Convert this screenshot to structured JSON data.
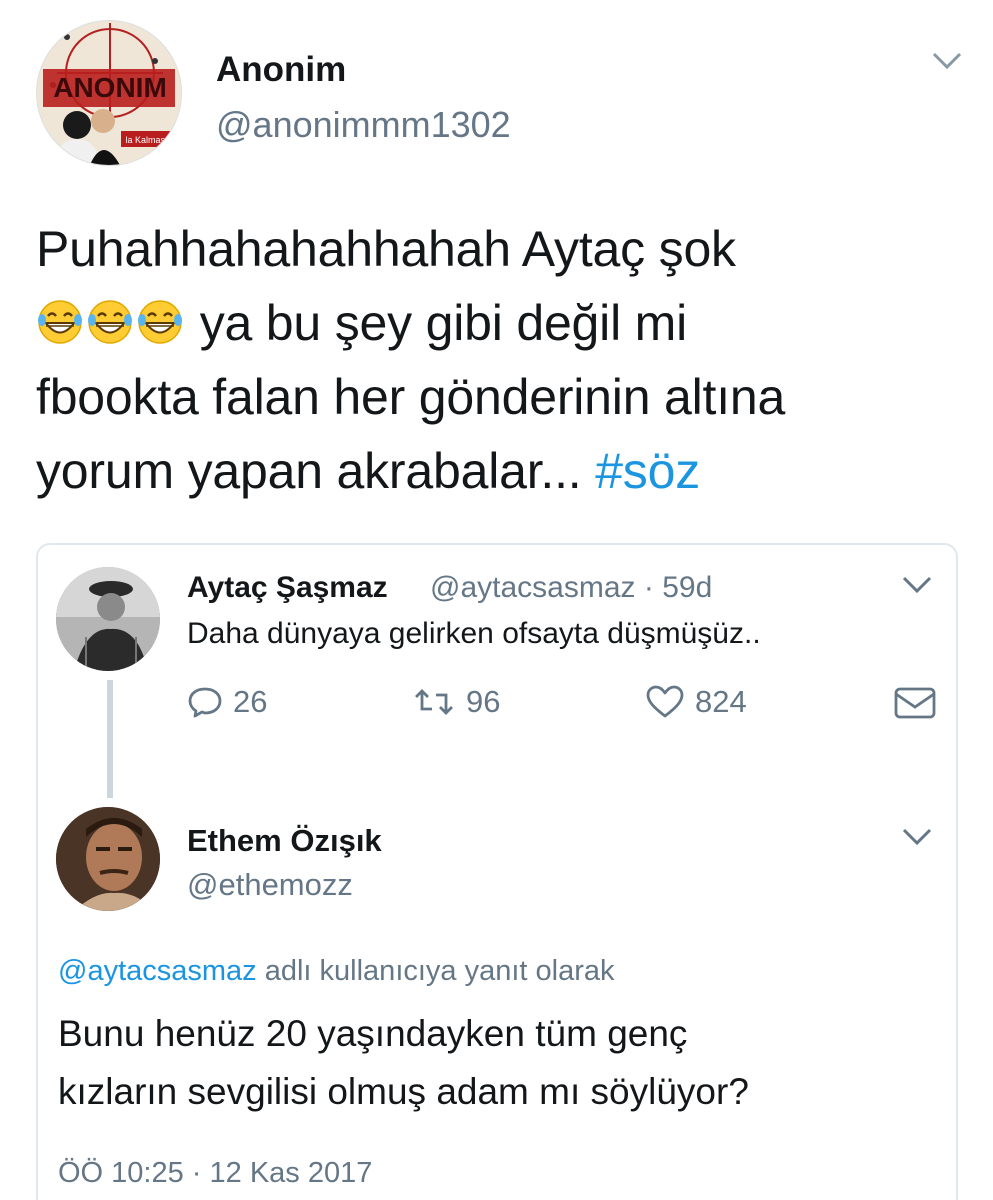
{
  "main_tweet": {
    "author_name": "Anonim",
    "author_handle": "@anonimmm1302",
    "avatar_text": "ANONIM",
    "avatar_subtext": "la Kalmasın",
    "text_lines": [
      "Puhahhahahahhahah Aytaç şok",
      "ya bu şey gibi değil mi",
      "fbookta falan her gönderinin altına",
      "yorum yapan akrabalar... "
    ],
    "hashtag": "#söz",
    "emoji_icon": "laughing-tears-icon"
  },
  "quoted_tweet": {
    "author_name": "Aytaç Şaşmaz",
    "author_handle": "@aytacsasmaz",
    "separator": "·",
    "age": "59d",
    "text": "Daha dünyaya gelirken ofsayta düşmüşüz..",
    "reply_count": "26",
    "retweet_count": "96",
    "like_count": "824"
  },
  "reply_tweet": {
    "author_name": "Ethem Özışık",
    "author_handle": "@ethemozz",
    "reply_to_handle": "@aytacsasmaz",
    "reply_to_suffix": " adlı kullanıcıya yanıt olarak",
    "text_lines": [
      "Bunu henüz 20 yaşındayken tüm genç",
      "kızların sevgilisi olmuş adam mı söylüyor?"
    ],
    "timestamp": "ÖÖ 10:25 · 12 Kas 2017"
  },
  "colors": {
    "link_blue": "#1b95e0",
    "secondary_gray": "#657786",
    "border": "#e1e8ed",
    "text": "#14171a"
  }
}
